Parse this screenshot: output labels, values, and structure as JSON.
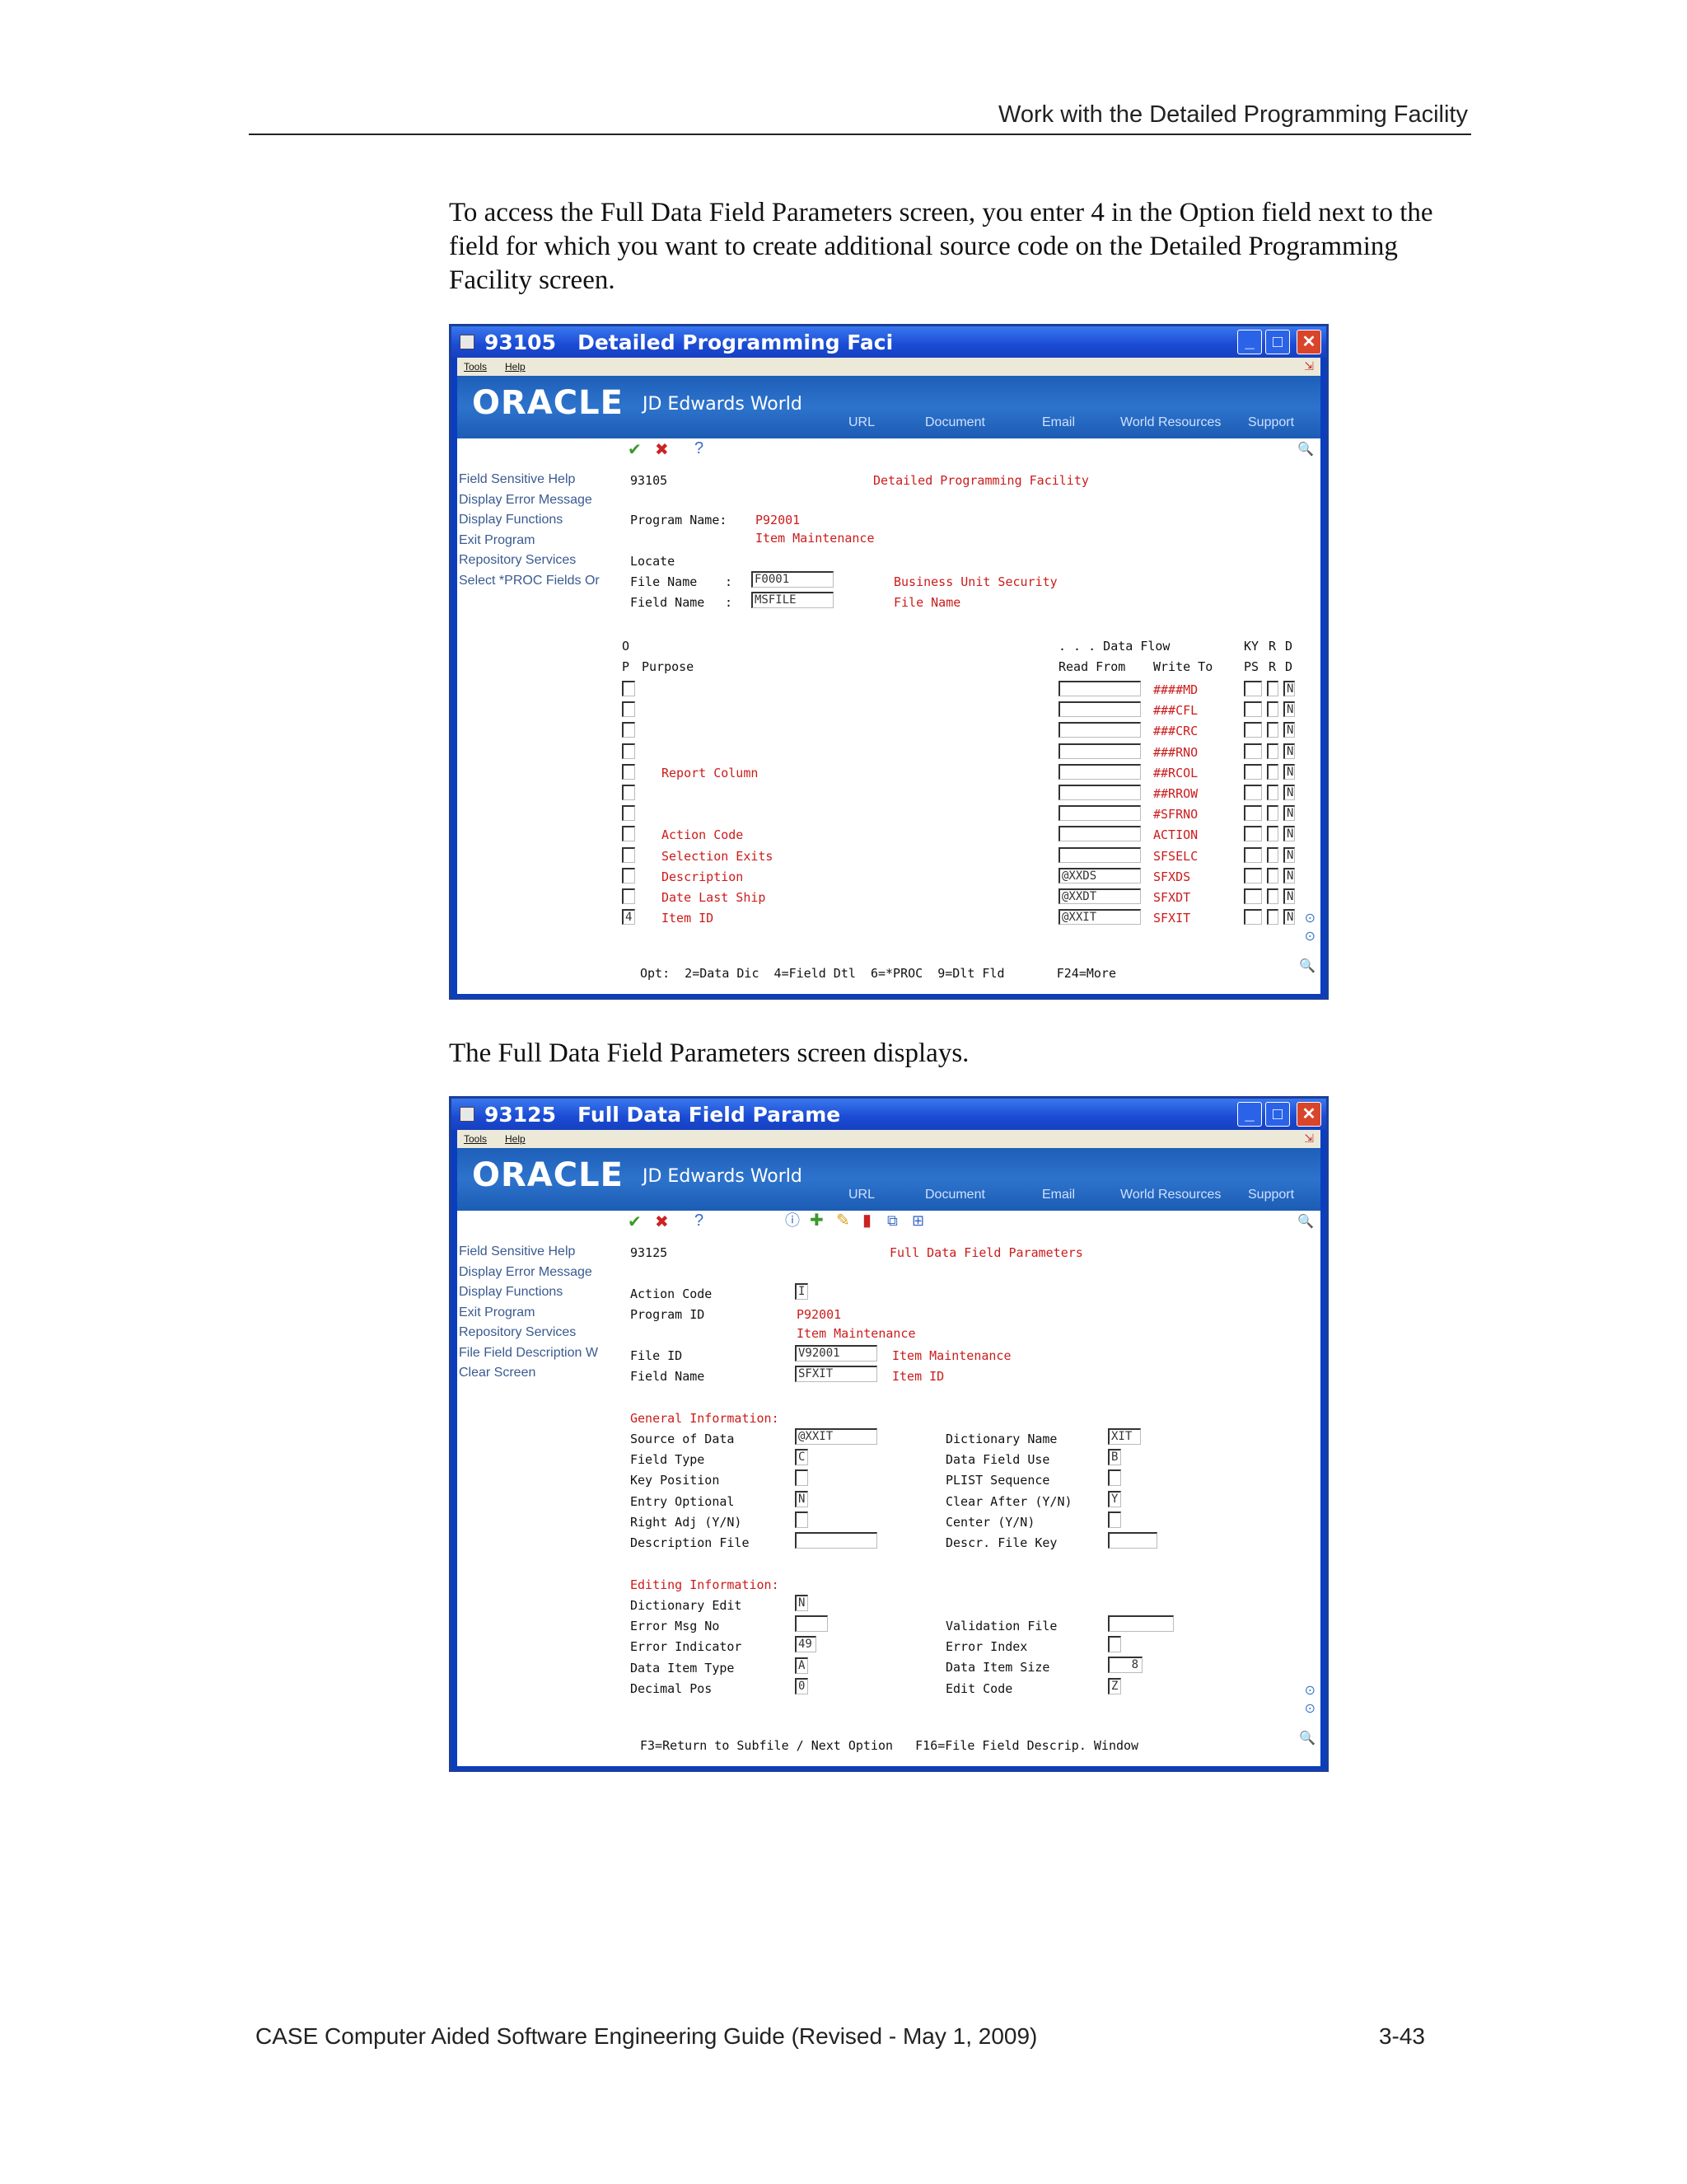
{
  "header": {
    "title": "Work with the Detailed Programming Facility"
  },
  "intro_paragraph": "To access the Full Data Field Parameters screen, you enter 4 in the Option field next to the field for which you want to create additional source code on the Detailed Programming Facility screen.",
  "mid_paragraph": "The Full Data Field Parameters screen displays.",
  "footer": {
    "left": "CASE Computer Aided Software Engineering Guide (Revised - May 1, 2009)",
    "right": "3-43"
  },
  "chrome": {
    "menu_tools": "Tools",
    "menu_help": "Help",
    "oracle": "ORACLE",
    "jde": "JD Edwards World",
    "links": [
      "URL",
      "Document",
      "Email",
      "World Resources",
      "Support"
    ]
  },
  "screen1": {
    "window_title": "93105   Detailed Programming Faci",
    "sidebar": [
      "Field Sensitive Help",
      "Display Error Message",
      "Display Functions",
      "Exit Program",
      "Repository Services",
      "Select *PROC Fields Or"
    ],
    "screen_id": "93105",
    "screen_title": "Detailed Programming Facility",
    "program_name_label": "Program Name:",
    "program_name": "P92001",
    "program_desc": "Item Maintenance",
    "locate_label": "Locate",
    "file_name_label": "File Name",
    "field_name_label": "Field Name",
    "file_name_value": "F0001",
    "field_name_value": "MSFILE",
    "file_desc": "Business Unit Security",
    "field_desc": "File Name",
    "col_o": "O",
    "col_p": "P",
    "col_purpose": "Purpose",
    "col_dataflow": ". . . Data Flow",
    "col_readfrom": "Read From",
    "col_writeto": "Write To",
    "col_ky": "KY",
    "col_ps": "PS",
    "col_r": "R",
    "col_d": "D",
    "col_rn": "R",
    "col_dd": "D",
    "rows": [
      {
        "opt": "",
        "purpose": "",
        "read": "",
        "write": "####MD",
        "d": "N"
      },
      {
        "opt": "",
        "purpose": "",
        "read": "",
        "write": "###CFL",
        "d": "N"
      },
      {
        "opt": "",
        "purpose": "",
        "read": "",
        "write": "###CRC",
        "d": "N"
      },
      {
        "opt": "",
        "purpose": "",
        "read": "",
        "write": "###RNO",
        "d": "N"
      },
      {
        "opt": "",
        "purpose": "Report Column",
        "read": "",
        "write": "##RCOL",
        "d": "N"
      },
      {
        "opt": "",
        "purpose": "",
        "read": "",
        "write": "##RROW",
        "d": "N"
      },
      {
        "opt": "",
        "purpose": "",
        "read": "",
        "write": "#SFRNO",
        "d": "N"
      },
      {
        "opt": "",
        "purpose": "Action Code",
        "read": "",
        "write": "ACTION",
        "d": "N"
      },
      {
        "opt": "",
        "purpose": "Selection Exits",
        "read": "",
        "write": "SFSELC",
        "d": "N"
      },
      {
        "opt": "",
        "purpose": "Description",
        "read": "@XXDS",
        "write": "SFXDS",
        "d": "N"
      },
      {
        "opt": "",
        "purpose": "Date Last Ship",
        "read": "@XXDT",
        "write": "SFXDT",
        "d": "N"
      },
      {
        "opt": "4",
        "purpose": "Item ID",
        "read": "@XXIT",
        "write": "SFXIT",
        "d": "N"
      }
    ],
    "footer_line": "Opt:  2=Data Dic  4=Field Dtl  6=*PROC  9=Dlt Fld       F24=More"
  },
  "screen2": {
    "window_title": "93125   Full Data Field Parame",
    "sidebar": [
      "Field Sensitive Help",
      "Display Error Message",
      "Display Functions",
      "Exit Program",
      "Repository Services",
      "File Field Description W",
      "Clear Screen"
    ],
    "screen_id": "93125",
    "screen_title": "Full Data Field Parameters",
    "action_code_label": "Action Code",
    "action_code": "I",
    "program_id_label": "Program ID",
    "program_id": "P92001",
    "program_desc": "Item Maintenance",
    "file_id_label": "File ID",
    "file_id": "V92001",
    "file_desc": "Item Maintenance",
    "field_name_label": "Field Name",
    "field_name": "SFXIT",
    "field_desc": "Item ID",
    "general_header": "General Information:",
    "general_left": [
      {
        "label": "Source of Data",
        "value": "@XXIT"
      },
      {
        "label": "Field Type",
        "value": "C"
      },
      {
        "label": "Key Position",
        "value": ""
      },
      {
        "label": "Entry Optional",
        "value": "N"
      },
      {
        "label": "Right Adj (Y/N)",
        "value": ""
      },
      {
        "label": "Description File",
        "value": ""
      }
    ],
    "general_right": [
      {
        "label": "Dictionary Name",
        "value": "XIT"
      },
      {
        "label": "Data Field Use",
        "value": "B"
      },
      {
        "label": "PLIST Sequence",
        "value": ""
      },
      {
        "label": "Clear After (Y/N)",
        "value": "Y"
      },
      {
        "label": "Center (Y/N)",
        "value": ""
      },
      {
        "label": "Descr. File Key",
        "value": ""
      }
    ],
    "editing_header": "Editing Information:",
    "editing_left": [
      {
        "label": "Dictionary Edit",
        "value": "N"
      },
      {
        "label": "Error Msg No",
        "value": ""
      },
      {
        "label": "Error Indicator",
        "value": "49"
      },
      {
        "label": "Data Item Type",
        "value": "A"
      },
      {
        "label": "Decimal Pos",
        "value": "0"
      }
    ],
    "editing_right": [
      {
        "label": "Validation File",
        "value": ""
      },
      {
        "label": "Error Index",
        "value": ""
      },
      {
        "label": "Data Item Size",
        "value": "8"
      },
      {
        "label": "Edit Code",
        "value": "Z"
      }
    ],
    "footer_line": "F3=Return to Subfile / Next Option   F16=File Field Descrip. Window"
  }
}
